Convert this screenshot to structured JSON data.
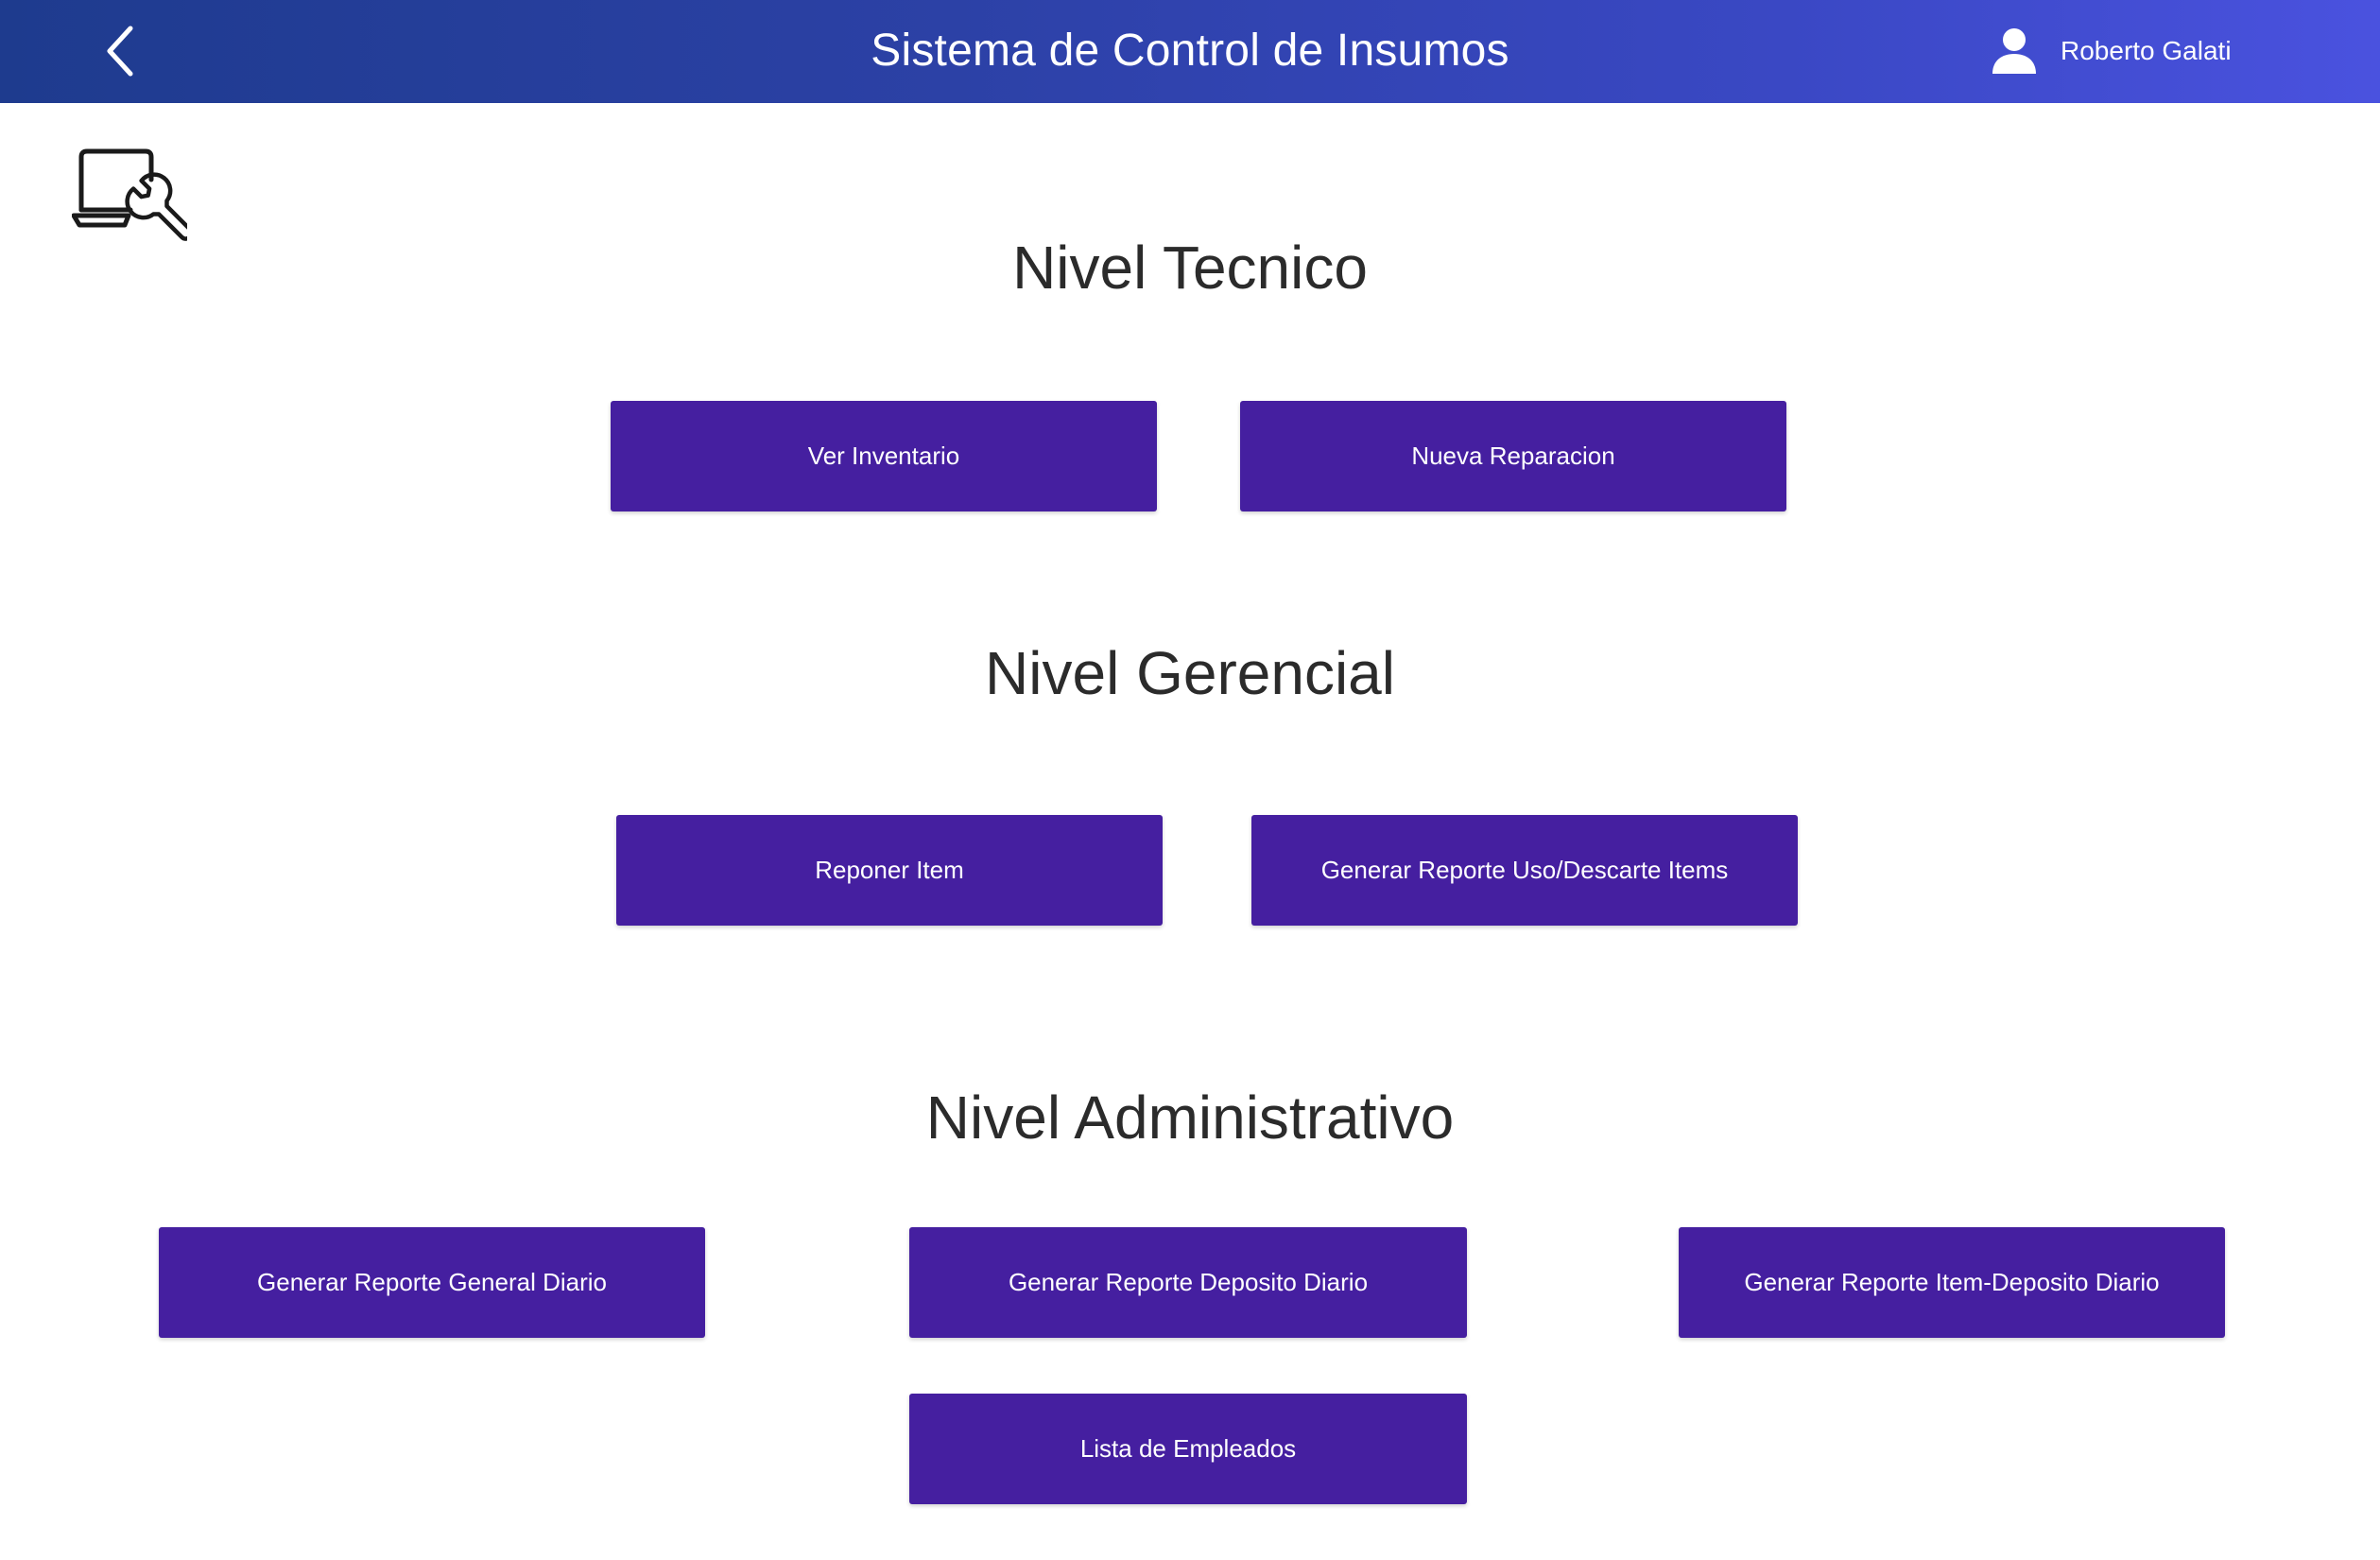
{
  "header": {
    "title": "Sistema de Control de Insumos",
    "user_name": "Roberto Galati",
    "back_icon": "chevron-left-icon",
    "user_icon": "user-icon"
  },
  "logo": {
    "icon": "laptop-wrench-icon"
  },
  "sections": {
    "tecnico": {
      "title": "Nivel Tecnico",
      "buttons": [
        "Ver Inventario",
        "Nueva Reparacion"
      ]
    },
    "gerencial": {
      "title": "Nivel Gerencial",
      "buttons": [
        "Reponer Item",
        "Generar Reporte Uso/Descarte Items"
      ]
    },
    "administrativo": {
      "title": "Nivel Administrativo",
      "buttons": [
        "Generar Reporte General Diario",
        "Generar Reporte Deposito Diario",
        "Generar Reporte Item-Deposito Diario",
        "Lista de Empleados"
      ]
    }
  },
  "colors": {
    "header_gradient_start": "#1e3b8e",
    "header_gradient_end": "#4a52df",
    "button_bg": "#451fa0",
    "button_text": "#ffffff",
    "title_text": "#2b2b2b"
  }
}
